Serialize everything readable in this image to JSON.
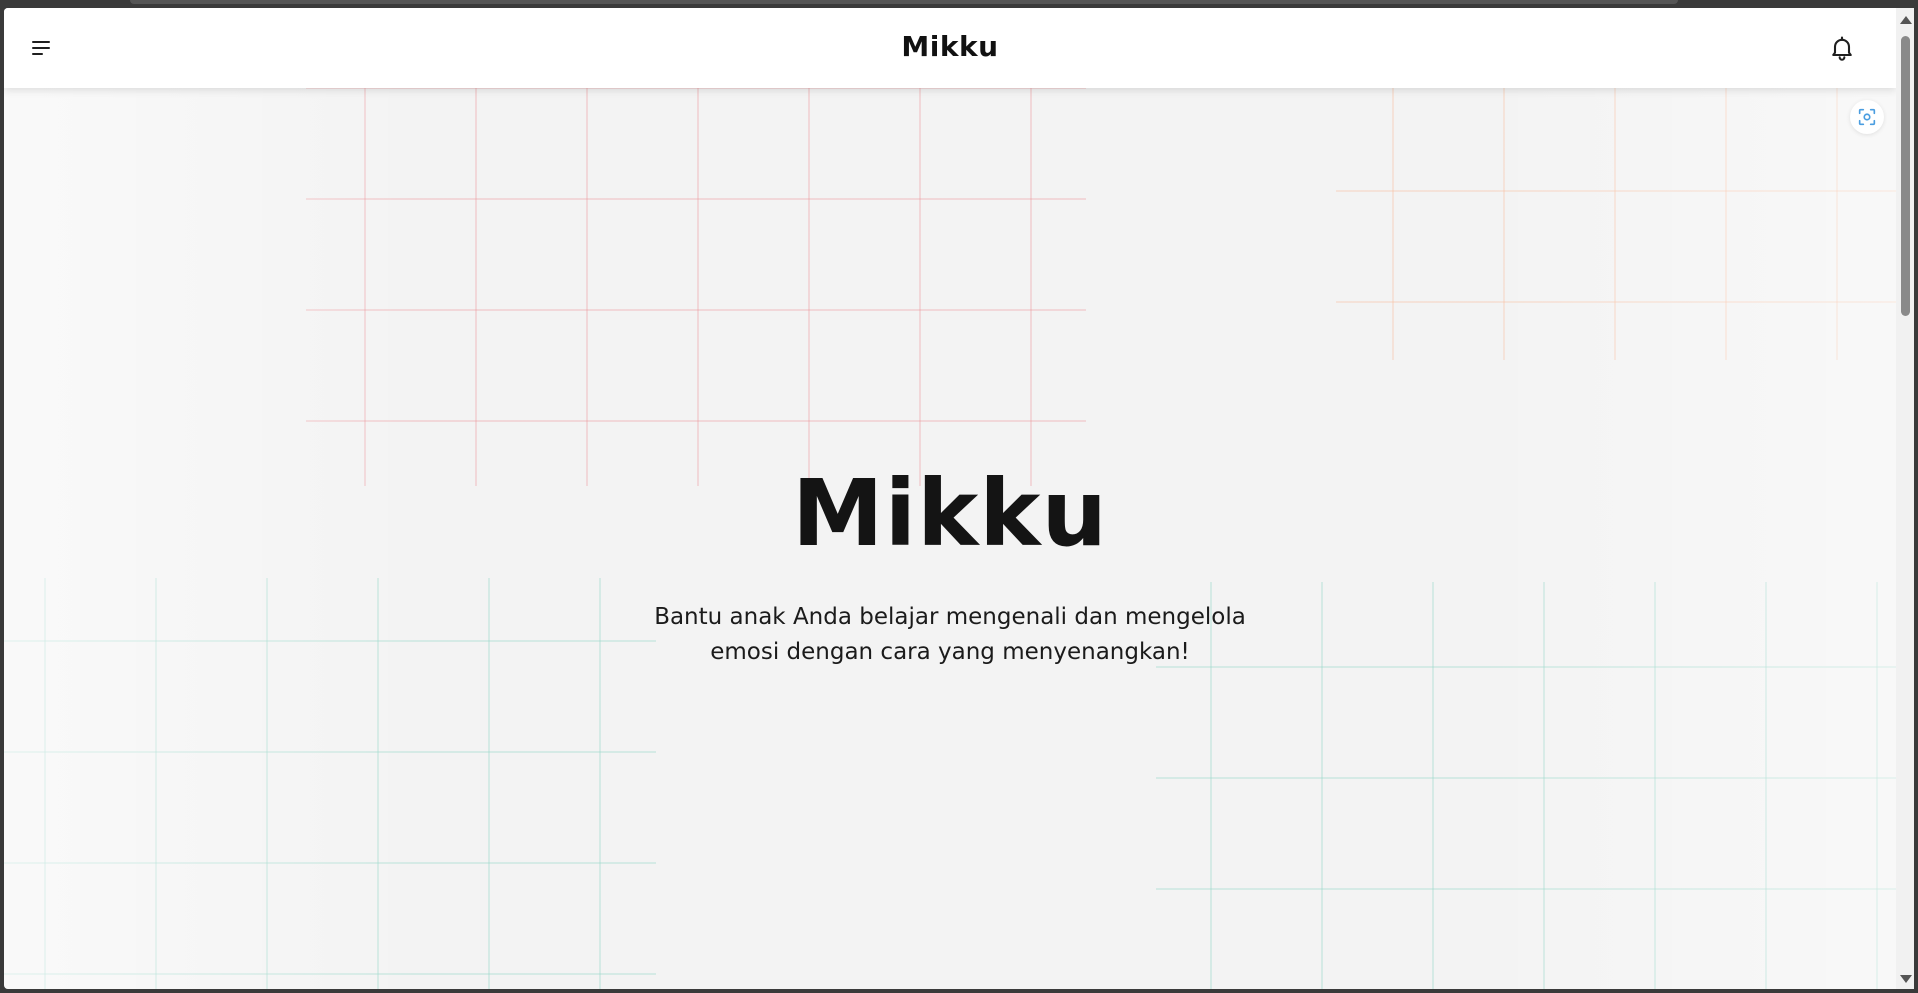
{
  "header": {
    "brand": "Mikku",
    "menu_icon": "hamburger-menu-icon",
    "notification_icon": "bell-icon"
  },
  "floating": {
    "scan_icon": "scan-camera-icon"
  },
  "hero": {
    "title": "Mikku",
    "subtitle": "Bantu anak Anda belajar mengenali dan mengelola emosi dengan cara yang menyenangkan!"
  },
  "colors": {
    "background": "#f3f3f3",
    "header_bg": "#ffffff",
    "text": "#141414",
    "grid_pink": "#eb969b",
    "grid_peach": "#fab996",
    "grid_mint": "#96d7c8",
    "scan_accent": "#4a9de0"
  }
}
